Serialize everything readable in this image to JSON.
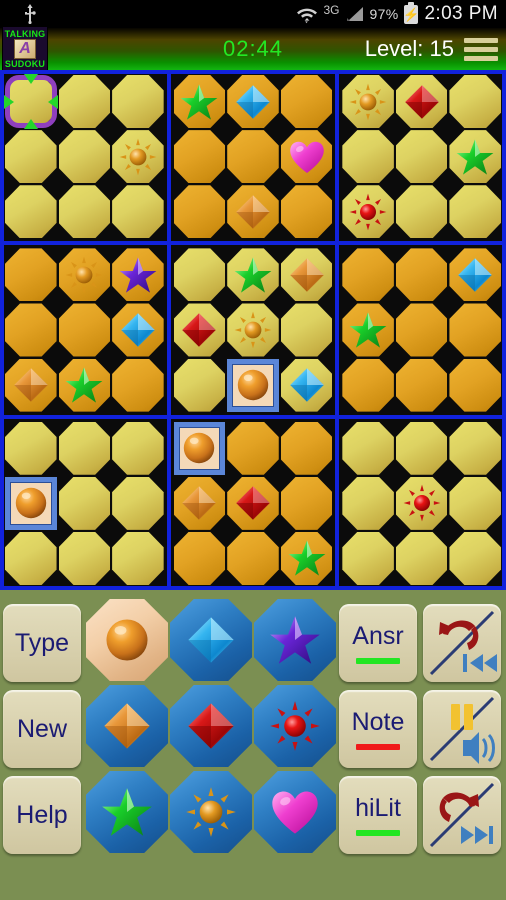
{
  "status_bar": {
    "usb_icon": "usb-icon",
    "wifi_icon": "wifi-icon",
    "network": "3G",
    "signal_icon": "signal-bars-icon",
    "battery_percent": "97%",
    "battery_icon": "battery-charging-icon",
    "time": "2:03 PM"
  },
  "app_bar": {
    "logo_top": "TALKING",
    "logo_letter": "A",
    "logo_bottom": "SUDOKU",
    "timer": "02:44",
    "level": "Level: 15",
    "menu_icon": "hamburger-menu-icon",
    "timer_color": "#23e823",
    "level_color": "#ffffff"
  },
  "board": {
    "grid_line_color": "#1122dd",
    "background": "#000000",
    "cell_light_color": "#ddd262",
    "cell_dark_color": "#e2a223",
    "selected_cell_fill": "#f4d9b8",
    "selected_cell_border": "#5b86d8",
    "cursor_border": "#8f3fbf",
    "cursor_arrow_color": "#23d62a",
    "blocks": [
      {
        "index": 0,
        "shade": "light",
        "cells": [
          "",
          "",
          "",
          "",
          "",
          "sun-orange",
          "",
          "",
          ""
        ],
        "cursor_cell": 0
      },
      {
        "index": 1,
        "shade": "dark",
        "cells": [
          "star-green",
          "diamond-blue",
          "",
          "",
          "",
          "heart-pink",
          "",
          "diamond-orange",
          ""
        ]
      },
      {
        "index": 2,
        "shade": "light",
        "cells": [
          "sun-orange",
          "diamond-red",
          "",
          "",
          "",
          "star-green",
          "sun-red",
          "",
          ""
        ]
      },
      {
        "index": 3,
        "shade": "dark",
        "cells": [
          "",
          "sun-orange",
          "star-purple",
          "",
          "",
          "diamond-blue",
          "diamond-orange",
          "star-green",
          ""
        ]
      },
      {
        "index": 4,
        "shade": "light",
        "cells": [
          "",
          "star-green",
          "diamond-orange",
          "diamond-red",
          "sun-orange",
          "",
          "",
          "ball-orange",
          "diamond-blue"
        ],
        "selected_cell": 7
      },
      {
        "index": 5,
        "shade": "dark",
        "cells": [
          "",
          "",
          "diamond-blue",
          "star-green",
          "",
          "",
          "",
          "",
          ""
        ]
      },
      {
        "index": 6,
        "shade": "light",
        "cells": [
          "",
          "",
          "",
          "ball-orange",
          "",
          "",
          "",
          "",
          ""
        ],
        "selected_cell": 3
      },
      {
        "index": 7,
        "shade": "dark",
        "cells": [
          "ball-orange",
          "",
          "",
          "diamond-orange",
          "diamond-red",
          "",
          "",
          "",
          "star-green"
        ],
        "selected_cell": 0
      },
      {
        "index": 8,
        "shade": "light",
        "cells": [
          "",
          "",
          "",
          "",
          "sun-red",
          "",
          "",
          "",
          ""
        ]
      }
    ]
  },
  "panel": {
    "background": "#7b8f52",
    "left_buttons": [
      {
        "label": "Type",
        "name": "type-button"
      },
      {
        "label": "New",
        "name": "new-button"
      },
      {
        "label": "Help",
        "name": "help-button"
      }
    ],
    "symbols": [
      {
        "name": "ball-orange",
        "selected": true
      },
      {
        "name": "diamond-blue",
        "selected": false
      },
      {
        "name": "star-purple",
        "selected": false
      },
      {
        "name": "diamond-orange",
        "selected": false
      },
      {
        "name": "diamond-red",
        "selected": false
      },
      {
        "name": "sun-red",
        "selected": false
      },
      {
        "name": "star-green",
        "selected": false
      },
      {
        "name": "sun-orange",
        "selected": false
      },
      {
        "name": "heart-pink",
        "selected": false
      }
    ],
    "mode_buttons": [
      {
        "label": "Ansr",
        "bar_color": "#22e622",
        "name": "answer-mode-button"
      },
      {
        "label": "Note",
        "bar_color": "#f01a1a",
        "name": "note-mode-button"
      },
      {
        "label": "hiLit",
        "bar_color": "#22e622",
        "name": "highlight-mode-button"
      }
    ],
    "action_buttons": [
      {
        "name": "undo-rewind-button",
        "icons": "undo-icon / rewind-icon"
      },
      {
        "name": "pause-sound-button",
        "icons": "pause-icon / speaker-icon"
      },
      {
        "name": "redo-forward-button",
        "icons": "redo-icon / fast-forward-icon"
      }
    ],
    "button_face_color": "#d9d2b0",
    "button_text_color": "#1b1b73"
  }
}
